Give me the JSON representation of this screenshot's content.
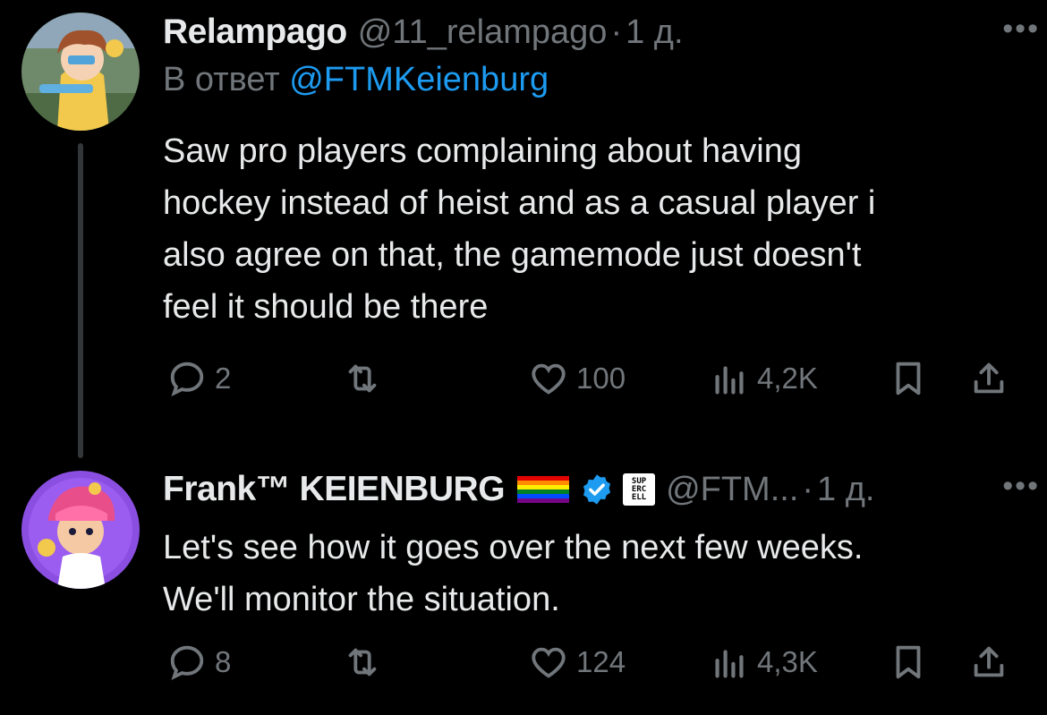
{
  "tweets": [
    {
      "author_name": "Relampago",
      "handle": "@11_relampago",
      "separator": "·",
      "time": "1 д.",
      "reply_prefix": "В ответ",
      "reply_mention": "@FTMKeienburg",
      "text": "Saw pro players complaining about having\nhockey instead of heist and as a casual player i\nalso agree on that, the gamemode just doesn't\nfeel it should be there",
      "replies": "2",
      "retweets": "",
      "likes": "100",
      "views": "4,2K"
    },
    {
      "author_name": "Frank™ KEIENBURG",
      "handle": "@FTM...",
      "separator": "·",
      "time": "1 д.",
      "affiliate_badge_text": "SUP\nERC\nELL",
      "text": "Let's see how it goes over the next few weeks.\nWe'll monitor the situation.",
      "replies": "8",
      "retweets": "",
      "likes": "124",
      "views": "4,3K"
    }
  ],
  "more_label": "•••",
  "colors": {
    "background": "#000000",
    "text_primary": "#e7e9ea",
    "text_secondary": "#71767b",
    "accent": "#1d9bf0",
    "thread_line": "#333639"
  },
  "icons": [
    "reply-icon",
    "retweet-icon",
    "like-icon",
    "views-icon",
    "bookmark-icon",
    "share-icon",
    "verified-icon",
    "rainbow-flag-icon",
    "more-icon"
  ]
}
